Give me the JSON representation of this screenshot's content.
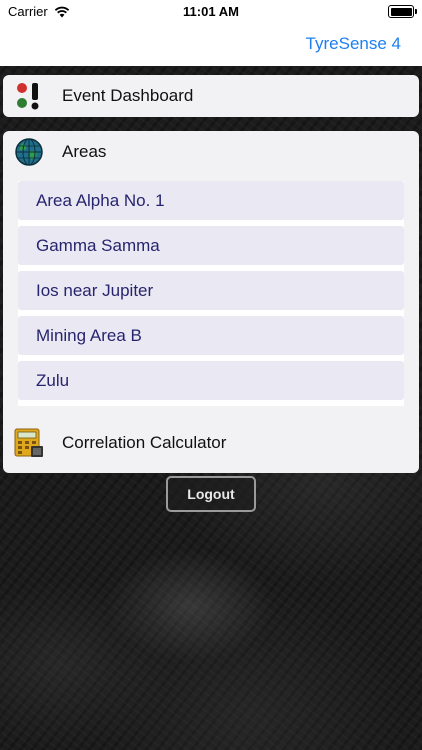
{
  "status_bar": {
    "carrier": "Carrier",
    "time": "11:01 AM",
    "battery_level": 1.0
  },
  "nav": {
    "title": "TyreSense 4"
  },
  "event_dashboard": {
    "label": "Event Dashboard",
    "icon": "traffic-light-icon"
  },
  "areas": {
    "label": "Areas",
    "icon": "globe-icon",
    "items": [
      {
        "label": "Area Alpha No. 1"
      },
      {
        "label": "Gamma Samma"
      },
      {
        "label": "Ios near Jupiter"
      },
      {
        "label": "Mining Area B"
      },
      {
        "label": "Zulu"
      }
    ]
  },
  "correlation_calculator": {
    "label": "Correlation Calculator",
    "icon": "calculator-icon"
  },
  "logout": {
    "label": "Logout"
  },
  "colors": {
    "nav_title": "#1f7ff0",
    "area_text": "#27246e",
    "area_item_bg": "#eae9f3"
  }
}
